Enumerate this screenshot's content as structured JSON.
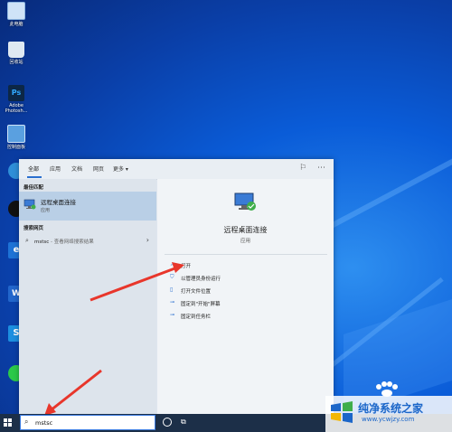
{
  "desktop": {
    "icons": [
      {
        "label": "此电脑",
        "icon": "computer-icon",
        "color": "#cfe3f7"
      },
      {
        "label": "回收站",
        "icon": "recycle-bin-icon",
        "color": "#dfe9f2"
      },
      {
        "label": "Adobe Photosh...",
        "icon": "photoshop-icon",
        "color": "#0c2746"
      },
      {
        "label": "控制面板",
        "icon": "control-panel-icon",
        "color": "#5aa0e0"
      }
    ]
  },
  "start_menu": {
    "tabs": [
      "全部",
      "应用",
      "文档",
      "网页",
      "更多 ▾"
    ],
    "best_match_title": "最佳匹配",
    "best_match": {
      "name": "远程桌面连接",
      "type": "应用"
    },
    "web_title": "搜索网页",
    "web_result": {
      "query": "mstsc",
      "suffix": " - 查看网络搜索结果"
    },
    "detail": {
      "name": "远程桌面连接",
      "type": "应用",
      "actions": [
        {
          "icon": "open-icon",
          "label": "打开"
        },
        {
          "icon": "run-as-admin-icon",
          "label": "以管理员身份运行"
        },
        {
          "icon": "file-location-icon",
          "label": "打开文件位置"
        },
        {
          "icon": "pin-start-icon",
          "label": "固定到\"开始\"屏幕"
        },
        {
          "icon": "pin-taskbar-icon",
          "label": "固定到任务栏"
        }
      ]
    }
  },
  "taskbar": {
    "search_value": "mstsc"
  },
  "watermark": {
    "title": "纯净系统之家",
    "url": "www.ycwjzy.com"
  },
  "colors": {
    "accent": "#2a6fcf",
    "arrow": "#e8362b",
    "desktop_blue": "#0a5cd8"
  }
}
